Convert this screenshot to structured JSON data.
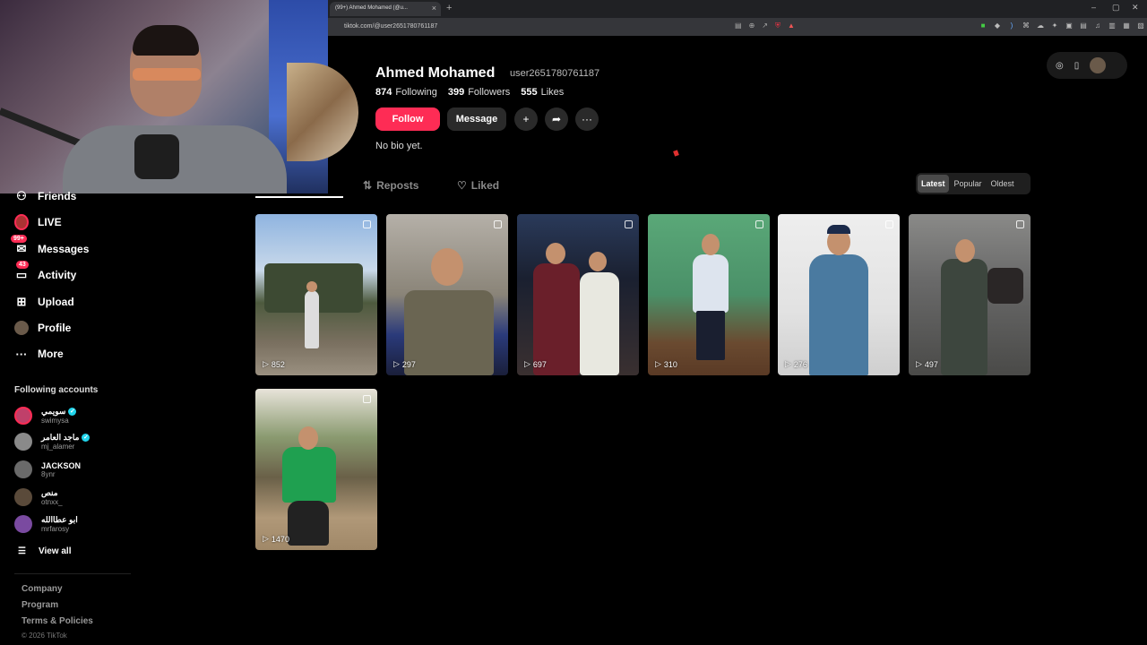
{
  "browser": {
    "tab_title": "(99+) Ahmed Mohamed (@u...",
    "tab_close": "×",
    "new_tab": "+",
    "url": "tiktok.com/@user2651780761187",
    "window_controls": [
      "–",
      "▢",
      "✕"
    ]
  },
  "sidebar": {
    "items": [
      {
        "label": "Friends",
        "icon": "friends-icon"
      },
      {
        "label": "LIVE",
        "icon": "live-icon"
      },
      {
        "label": "Messages",
        "icon": "messages-icon",
        "badge": "99+"
      },
      {
        "label": "Activity",
        "icon": "activity-icon",
        "badge": "43"
      },
      {
        "label": "Upload",
        "icon": "upload-icon"
      },
      {
        "label": "Profile",
        "icon": "profile-icon"
      },
      {
        "label": "More",
        "icon": "more-icon"
      }
    ],
    "following_title": "Following accounts",
    "accounts": [
      {
        "name": "سويمي",
        "handle": "swimysa",
        "verified": true
      },
      {
        "name": "ماجد العامر",
        "handle": "mj_alamer",
        "verified": true
      },
      {
        "name": "JACKSON",
        "handle": "8ynr",
        "verified": false
      },
      {
        "name": "منص",
        "handle": "otnxx_",
        "verified": false
      },
      {
        "name": "ابو عطاالله",
        "handle": "mrfarosy",
        "verified": false
      }
    ],
    "view_all": "View all",
    "footer": [
      "Company",
      "Program",
      "Terms & Policies"
    ],
    "copyright": "© 2026 TikTok"
  },
  "profile": {
    "name": "Ahmed Mohamed",
    "username": "user2651780761187",
    "following_count": "874",
    "following_label": "Following",
    "followers_count": "399",
    "followers_label": "Followers",
    "likes_count": "555",
    "likes_label": "Likes",
    "follow_label": "Follow",
    "message_label": "Message",
    "bio": "No bio yet."
  },
  "tabs": {
    "reposts": "Reposts",
    "liked": "Liked"
  },
  "sort": {
    "options": [
      "Latest",
      "Popular",
      "Oldest"
    ],
    "selected": "Latest"
  },
  "videos": [
    {
      "views": "852",
      "multi": true
    },
    {
      "views": "297",
      "multi": true
    },
    {
      "views": "697",
      "multi": true
    },
    {
      "views": "310",
      "multi": true
    },
    {
      "views": "276",
      "multi": true
    },
    {
      "views": "497",
      "multi": true
    },
    {
      "views": "1470",
      "multi": true
    }
  ],
  "colors": {
    "accent": "#fe2c55",
    "background": "#000000",
    "verified": "#20d5ec"
  }
}
